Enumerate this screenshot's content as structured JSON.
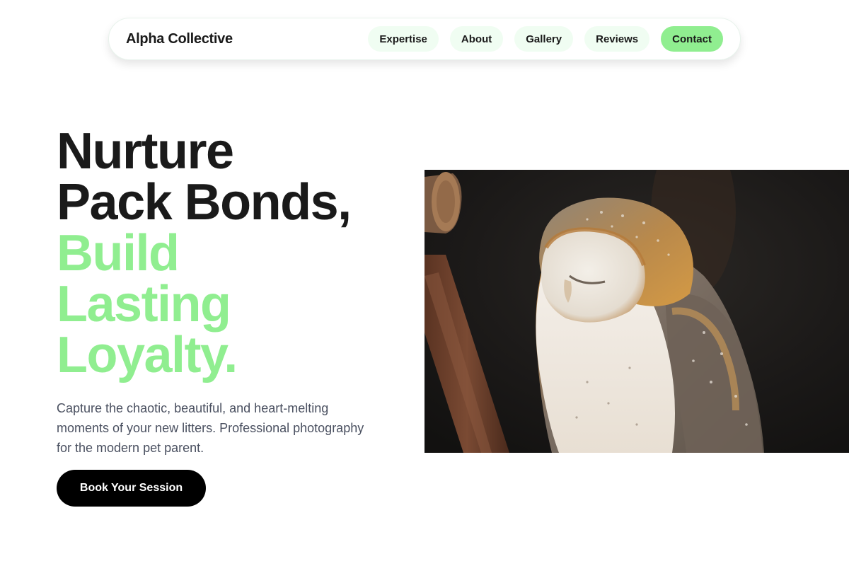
{
  "nav": {
    "brand": "Alpha Collective",
    "links": [
      {
        "label": "Expertise"
      },
      {
        "label": "About"
      },
      {
        "label": "Gallery"
      },
      {
        "label": "Reviews"
      },
      {
        "label": "Contact",
        "active": true
      }
    ]
  },
  "hero": {
    "headline_dark": [
      "Nurture",
      "Pack Bonds,"
    ],
    "headline_green": [
      "Build",
      "Lasting",
      "Loyalty."
    ],
    "subtitle": "Capture the chaotic, beautiful, and heart-melting moments of your new litters. Professional photography for the modern pet parent.",
    "cta_label": "Book Your Session",
    "image_subject": "barn-owl-photo"
  },
  "colors": {
    "accent": "#90ee90",
    "accent_light": "#f0fdf2",
    "text": "#1a1a1a",
    "muted": "#4a5060",
    "cta_bg": "#000000"
  }
}
